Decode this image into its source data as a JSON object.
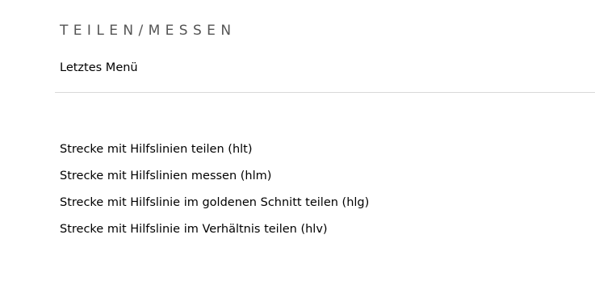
{
  "menu": {
    "title": "TEILEN/MESSEN",
    "back_label": "Letztes Menü",
    "items": [
      {
        "label": "Strecke mit Hilfslinien teilen (hlt)"
      },
      {
        "label": "Strecke mit Hilfslinien messen (hlm)"
      },
      {
        "label": "Strecke mit Hilfslinie im goldenen Schnitt teilen (hlg)"
      },
      {
        "label": "Strecke mit Hilfslinie im Verhältnis teilen (hlv)"
      }
    ]
  }
}
